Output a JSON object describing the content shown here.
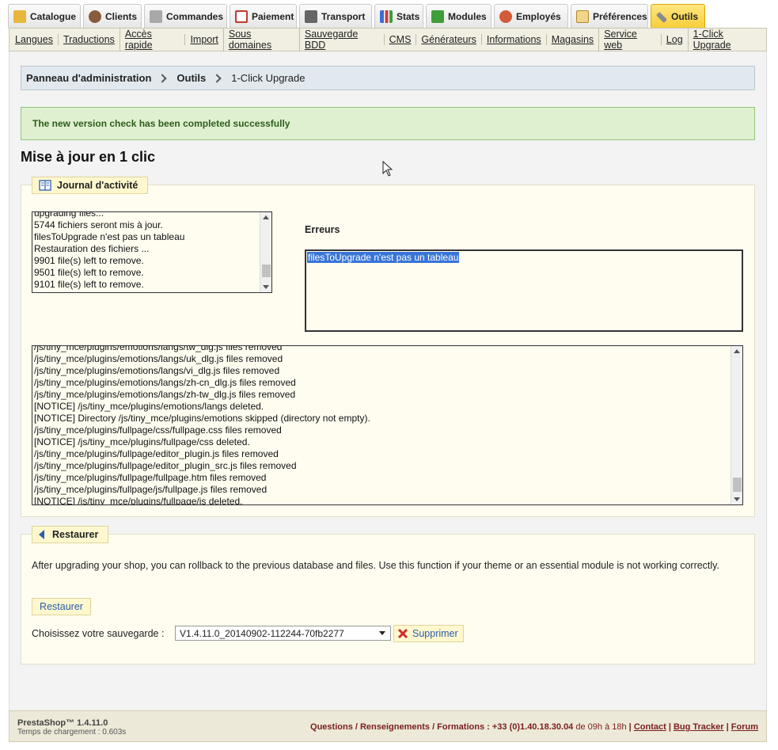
{
  "tabs": [
    {
      "label": "Catalogue",
      "icon": "folder-icon",
      "color": "#e7b63b"
    },
    {
      "label": "Clients",
      "icon": "user-icon",
      "color": "#8a5a3c"
    },
    {
      "label": "Commandes",
      "icon": "cart-icon",
      "color": "#7a7a7a"
    },
    {
      "label": "Paiement",
      "icon": "payment-icon",
      "color": "#c0392b"
    },
    {
      "label": "Transport",
      "icon": "truck-icon",
      "color": "#555555"
    },
    {
      "label": "Stats",
      "icon": "stats-icon",
      "color": "#3b6fd1"
    },
    {
      "label": "Modules",
      "icon": "puzzle-icon",
      "color": "#3f9e3a"
    },
    {
      "label": "Employés",
      "icon": "employee-icon",
      "color": "#d35b3a"
    },
    {
      "label": "Préférences",
      "icon": "preferences-icon",
      "color": "#d8a43b"
    },
    {
      "label": "Outils",
      "icon": "tools-icon",
      "color": "#6b6b6b"
    }
  ],
  "subnav": [
    "Langues",
    "Traductions",
    "Accès rapide",
    "Import",
    "Sous domaines",
    "Sauvegarde BDD",
    "CMS",
    "Générateurs",
    "Informations",
    "Magasins",
    "Service web",
    "Log",
    "1-Click Upgrade"
  ],
  "breadcrumb": {
    "root": "Panneau d'administration",
    "section": "Outils",
    "current": "1-Click Upgrade"
  },
  "alert": "The new version check has been completed successfully",
  "page_title": "Mise à jour en 1 clic",
  "activity": {
    "legend": "Journal d'activité",
    "quick_log": [
      "upgrading files...",
      "5744 fichiers seront mis à jour.",
      "filesToUpgrade n'est pas un tableau",
      "Restauration des fichiers ...",
      "9901 file(s) left to remove.",
      "9501 file(s) left to remove.",
      "9101 file(s) left to remove."
    ],
    "errors_label": "Erreurs",
    "error_text": "filesToUpgrade n'est pas un tableau",
    "full_log": [
      "/js/tiny_mce/plugins/emotions/langs/tw_dlg.js files removed",
      "/js/tiny_mce/plugins/emotions/langs/uk_dlg.js files removed",
      "/js/tiny_mce/plugins/emotions/langs/vi_dlg.js files removed",
      "/js/tiny_mce/plugins/emotions/langs/zh-cn_dlg.js files removed",
      "/js/tiny_mce/plugins/emotions/langs/zh-tw_dlg.js files removed",
      "[NOTICE] /js/tiny_mce/plugins/emotions/langs deleted.",
      "[NOTICE] Directory /js/tiny_mce/plugins/emotions skipped (directory not empty).",
      "/js/tiny_mce/plugins/fullpage/css/fullpage.css files removed",
      "[NOTICE] /js/tiny_mce/plugins/fullpage/css deleted.",
      "/js/tiny_mce/plugins/fullpage/editor_plugin.js files removed",
      "/js/tiny_mce/plugins/fullpage/editor_plugin_src.js files removed",
      "/js/tiny_mce/plugins/fullpage/fullpage.htm files removed",
      "/js/tiny_mce/plugins/fullpage/js/fullpage.js files removed",
      "[NOTICE] /js/tiny_mce/plugins/fullpage/js deleted."
    ]
  },
  "restore": {
    "legend": "Restaurer",
    "description": "After upgrading your shop, you can rollback to the previous database and files. Use this function if your theme or an essential module is not working correctly.",
    "button": "Restaurer",
    "backup_label": "Choisissez votre sauvegarde :",
    "backup_value": "V1.4.11.0_20140902-112244-70fb2277",
    "delete_button": "Supprimer"
  },
  "footer": {
    "brand": "PrestaShop™ 1.4.11.0",
    "load_time": "Temps de chargement : 0.603s",
    "contact_text": "Questions / Renseignements / Formations :",
    "phone": "+33 (0)1.40.18.30.04",
    "hours": "de 09h à 18h",
    "links": [
      "Contact",
      "Bug Tracker",
      "Forum"
    ]
  }
}
